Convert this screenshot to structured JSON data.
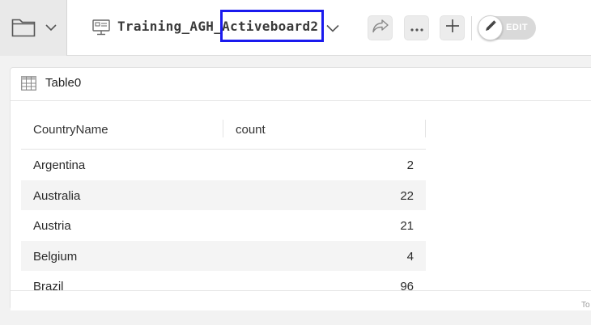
{
  "topbar": {
    "board_title": "Training_AGH_Activeboard2",
    "edit_label": "EDIT"
  },
  "widget": {
    "title": "Table0",
    "footer_text": "To"
  },
  "table": {
    "columns": [
      "CountryName",
      "count"
    ],
    "rows": [
      {
        "name": "Argentina",
        "count": "2"
      },
      {
        "name": "Australia",
        "count": "22"
      },
      {
        "name": "Austria",
        "count": "21"
      },
      {
        "name": "Belgium",
        "count": "4"
      },
      {
        "name": "Brazil",
        "count": "96"
      }
    ]
  },
  "icons": {
    "folder": "folder-icon",
    "board": "board-icon",
    "share": "share-icon",
    "more": "more-icon",
    "add": "plus-icon",
    "edit": "pencil-icon",
    "table": "table-icon"
  },
  "colors": {
    "highlight": "#1a1aee",
    "toggle_off": "#d9d9d9"
  }
}
